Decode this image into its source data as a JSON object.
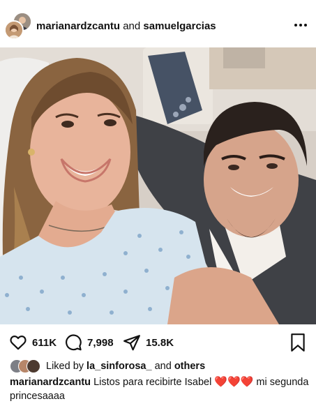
{
  "post": {
    "author_primary": "marianardzcantu",
    "author_connector": "and",
    "author_secondary": "samuelgarcias",
    "more_icon": "ellipsis-icon"
  },
  "stats": {
    "likes": "611K",
    "comments": "7,998",
    "shares": "15.8K"
  },
  "liked_by": {
    "prefix": "Liked by",
    "user": "la_sinforosa_",
    "connector": "and",
    "others": "others"
  },
  "caption": {
    "username": "marianardzcantu",
    "text": "Listos para recibirte Isabel",
    "hearts": "❤️❤️❤️",
    "text_after": "mi segunda princesaaaa"
  },
  "colors": {
    "heart_emoji": "#d8232a",
    "text": "#111111",
    "background": "#ffffff"
  }
}
